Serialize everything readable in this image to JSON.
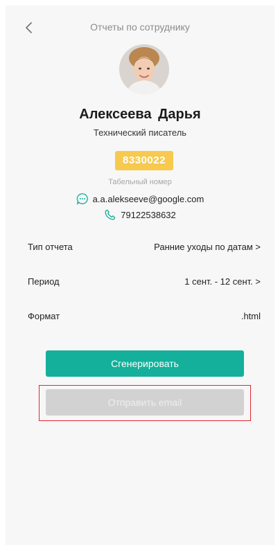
{
  "header": {
    "title": "Отчеты по сотруднику"
  },
  "employee": {
    "name": "Алексеева  Дарья",
    "position": "Технический писатель",
    "personnel_number": "8330022",
    "personnel_number_caption": "Табельный номер",
    "email": "a.a.alekseeve@google.com",
    "phone": "79122538632"
  },
  "settings": [
    {
      "label": "Тип отчета",
      "value": "Ранние уходы по датам >"
    },
    {
      "label": "Период",
      "value": "1 сент. - 12 сент. >"
    },
    {
      "label": "Формат",
      "value": ".html"
    }
  ],
  "actions": {
    "generate_label": "Сгенерировать",
    "send_email_label": "Отправить email"
  },
  "colors": {
    "accent": "#14b09b",
    "badge": "#f7c94f",
    "disabled": "#d2d2d2",
    "highlight": "#e0262f"
  }
}
